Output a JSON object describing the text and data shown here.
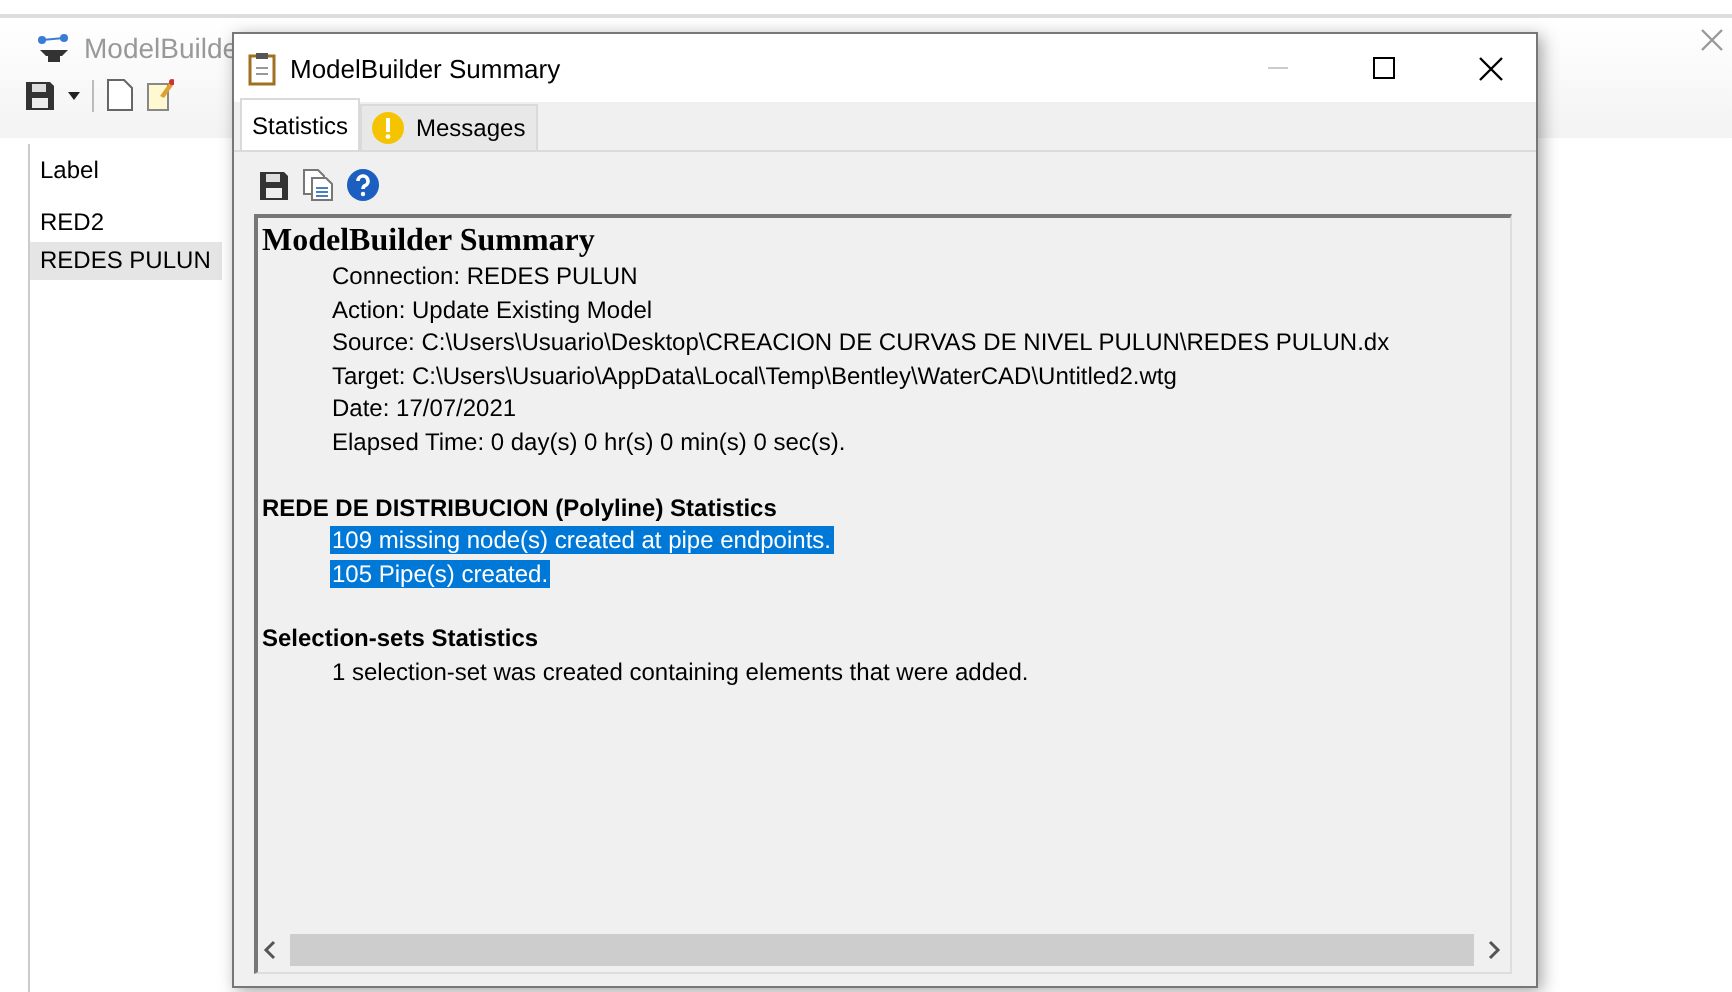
{
  "main_window": {
    "title": "ModelBuilde",
    "list": {
      "header": "Label",
      "items": [
        {
          "label": "RED2",
          "selected": false
        },
        {
          "label": "REDES PULUN",
          "selected": true
        }
      ]
    }
  },
  "dialog": {
    "title": "ModelBuilder Summary",
    "tabs": [
      {
        "label": "Statistics",
        "selected": true,
        "kind": "plain"
      },
      {
        "label": "Messages",
        "selected": false,
        "kind": "warning"
      }
    ],
    "report": {
      "sections": [
        {
          "kind": "heading",
          "title": "ModelBuilder Summary",
          "lines": [
            {
              "text": "Connection: REDES PULUN",
              "selected": false
            },
            {
              "text": "Action: Update Existing Model",
              "selected": false
            },
            {
              "text": "Source: C:\\Users\\Usuario\\Desktop\\CREACION DE CURVAS DE NIVEL PULUN\\REDES PULUN.dx",
              "selected": false
            },
            {
              "text": "Target: C:\\Users\\Usuario\\AppData\\Local\\Temp\\Bentley\\WaterCAD\\Untitled2.wtg",
              "selected": false
            },
            {
              "text": "Date: 17/07/2021",
              "selected": false
            },
            {
              "text": "Elapsed Time: 0 day(s) 0 hr(s) 0 min(s) 0 sec(s).",
              "selected": false
            }
          ]
        },
        {
          "kind": "section",
          "title": "REDE DE DISTRIBUCION (Polyline) Statistics",
          "lines": [
            {
              "text": "109 missing node(s) created at pipe endpoints.",
              "selected": true
            },
            {
              "text": "105 Pipe(s) created.",
              "selected": true
            }
          ]
        },
        {
          "kind": "section",
          "title": "Selection-sets Statistics",
          "lines": [
            {
              "text": "1 selection-set was created containing elements that were added.",
              "selected": false
            }
          ]
        }
      ]
    }
  }
}
